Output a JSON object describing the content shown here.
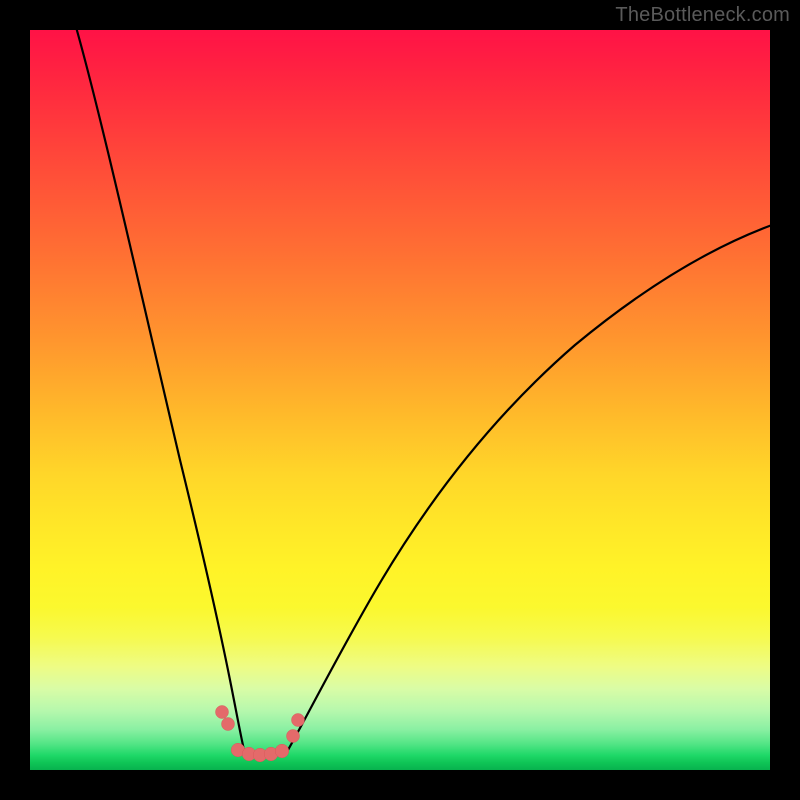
{
  "watermark": "TheBottleneck.com",
  "chart_data": {
    "type": "line",
    "title": "",
    "xlabel": "",
    "ylabel": "",
    "xlim": [
      0,
      100
    ],
    "ylim": [
      0,
      100
    ],
    "notes": "Bottleneck curve chart. Background gradient encodes severity: red (top, ~100% bottleneck) → yellow → green (bottom, ~0%). Two black curves form a V with minimum around x≈28–34. A short salmon/pink segment of data points sits at the bottom of the V. No numeric axis ticks are rendered.",
    "series": [
      {
        "name": "left-curve",
        "x": [
          6,
          9,
          12,
          15,
          18,
          21,
          24,
          26,
          28
        ],
        "y": [
          100,
          84,
          68,
          53,
          39,
          26,
          14,
          7,
          2
        ]
      },
      {
        "name": "right-curve",
        "x": [
          34,
          38,
          44,
          52,
          60,
          70,
          80,
          90,
          100
        ],
        "y": [
          2,
          6,
          14,
          25,
          35,
          45,
          54,
          61,
          67
        ]
      },
      {
        "name": "data-points",
        "color": "#e46a6a",
        "x": [
          25.5,
          26.5,
          28,
          29.5,
          31,
          32.5,
          34,
          35.5,
          36
        ],
        "y": [
          7.5,
          6,
          2.3,
          1.8,
          1.7,
          1.8,
          2.3,
          4.5,
          6.5
        ]
      }
    ],
    "gradient_stops": [
      {
        "pct": 0,
        "color": "#ff1246"
      },
      {
        "pct": 50,
        "color": "#ffd629"
      },
      {
        "pct": 78,
        "color": "#f6fa4e"
      },
      {
        "pct": 96,
        "color": "#52e585"
      },
      {
        "pct": 100,
        "color": "#08b24e"
      }
    ]
  }
}
